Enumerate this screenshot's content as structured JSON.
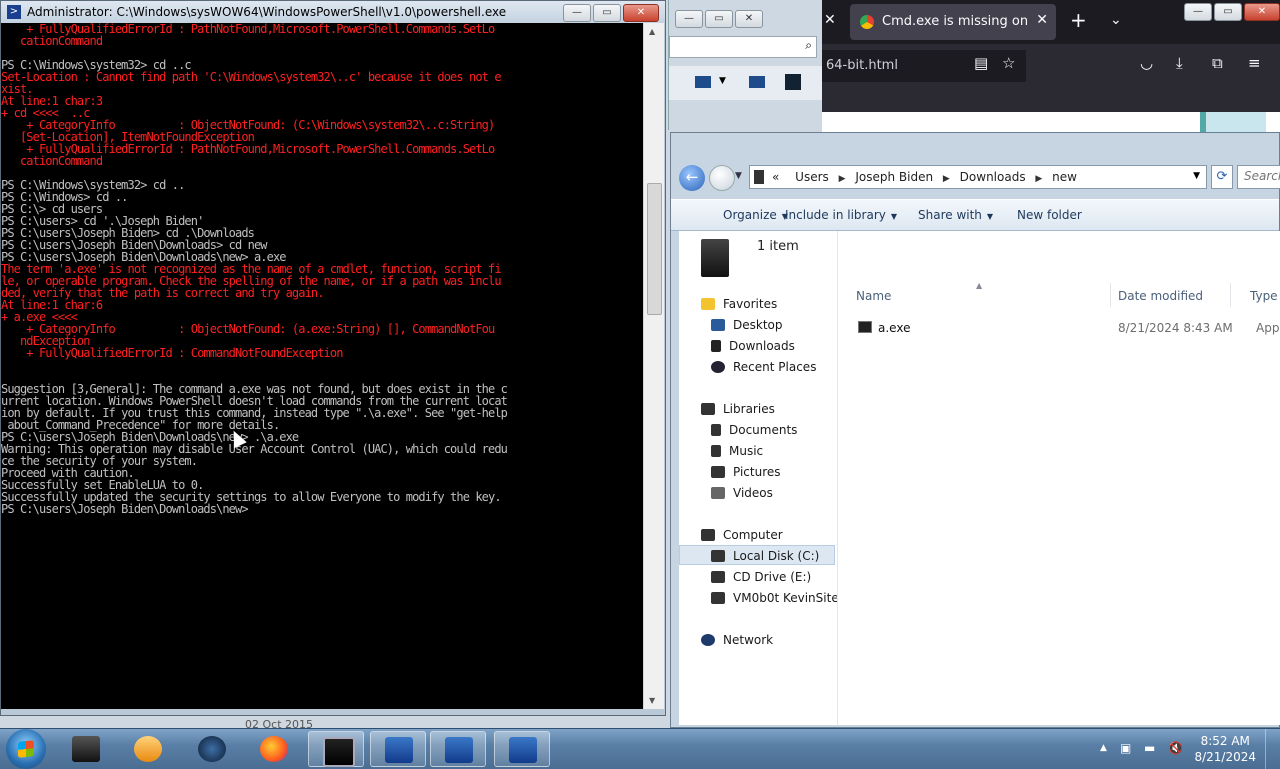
{
  "powershell": {
    "title": "Administrator: C:\\Windows\\sysWOW64\\WindowsPowerShell\\v1.0\\powershell.exe",
    "lines": [
      {
        "t": "    + FullyQualifiedErrorId : PathNotFound,Microsoft.PowerShell.Commands.SetLo",
        "c": "err"
      },
      {
        "t": "   cationCommand",
        "c": "err"
      },
      {
        "t": "",
        "c": "out"
      },
      {
        "t": "PS C:\\Windows\\system32> cd ..c",
        "c": "out"
      },
      {
        "t": "Set-Location : Cannot find path 'C:\\Windows\\system32\\..c' because it does not e",
        "c": "err"
      },
      {
        "t": "xist.",
        "c": "err"
      },
      {
        "t": "At line:1 char:3",
        "c": "err"
      },
      {
        "t": "+ cd <<<<  ..c",
        "c": "err"
      },
      {
        "t": "    + CategoryInfo          : ObjectNotFound: (C:\\Windows\\system32\\..c:String)",
        "c": "err"
      },
      {
        "t": "   [Set-Location], ItemNotFoundException",
        "c": "err"
      },
      {
        "t": "    + FullyQualifiedErrorId : PathNotFound,Microsoft.PowerShell.Commands.SetLo",
        "c": "err"
      },
      {
        "t": "   cationCommand",
        "c": "err"
      },
      {
        "t": "",
        "c": "out"
      },
      {
        "t": "PS C:\\Windows\\system32> cd ..",
        "c": "out"
      },
      {
        "t": "PS C:\\Windows> cd ..",
        "c": "out"
      },
      {
        "t": "PS C:\\> cd users",
        "c": "out"
      },
      {
        "t": "PS C:\\users> cd '.\\Joseph Biden'",
        "c": "out"
      },
      {
        "t": "PS C:\\users\\Joseph Biden> cd .\\Downloads",
        "c": "out"
      },
      {
        "t": "PS C:\\users\\Joseph Biden\\Downloads> cd new",
        "c": "out"
      },
      {
        "t": "PS C:\\users\\Joseph Biden\\Downloads\\new> a.exe",
        "c": "out"
      },
      {
        "t": "The term 'a.exe' is not recognized as the name of a cmdlet, function, script fi",
        "c": "err"
      },
      {
        "t": "le, or operable program. Check the spelling of the name, or if a path was inclu",
        "c": "err"
      },
      {
        "t": "ded, verify that the path is correct and try again.",
        "c": "err"
      },
      {
        "t": "At line:1 char:6",
        "c": "err"
      },
      {
        "t": "+ a.exe <<<<",
        "c": "err"
      },
      {
        "t": "    + CategoryInfo          : ObjectNotFound: (a.exe:String) [], CommandNotFou",
        "c": "err"
      },
      {
        "t": "   ndException",
        "c": "err"
      },
      {
        "t": "    + FullyQualifiedErrorId : CommandNotFoundException",
        "c": "err"
      },
      {
        "t": "",
        "c": "out"
      },
      {
        "t": "",
        "c": "out"
      },
      {
        "t": "Suggestion [3,General]: The command a.exe was not found, but does exist in the c",
        "c": "out"
      },
      {
        "t": "urrent location. Windows PowerShell doesn't load commands from the current locat",
        "c": "out"
      },
      {
        "t": "ion by default. If you trust this command, instead type \".\\a.exe\". See \"get-help",
        "c": "out"
      },
      {
        "t": " about_Command_Precedence\" for more details.",
        "c": "out"
      },
      {
        "t": "PS C:\\users\\Joseph Biden\\Downloads\\new> .\\a.exe",
        "c": "out"
      },
      {
        "t": "Warning: This operation may disable User Account Control (UAC), which could redu",
        "c": "out"
      },
      {
        "t": "ce the security of your system.",
        "c": "out"
      },
      {
        "t": "Proceed with caution.",
        "c": "out"
      },
      {
        "t": "Successfully set EnableLUA to 0.",
        "c": "out"
      },
      {
        "t": "Successfully updated the security settings to allow Everyone to modify the key.",
        "c": "out"
      },
      {
        "t": "PS C:\\users\\Joseph Biden\\Downloads\\new>",
        "c": "out"
      }
    ]
  },
  "behind_date": "02 Oct 2015",
  "browser": {
    "tab_title": "Cmd.exe is missing on Windo",
    "url_fragment": "64-bit.html"
  },
  "explorer": {
    "breadcrumb": [
      "Users",
      "Joseph Biden",
      "Downloads",
      "new"
    ],
    "crumb_prefix": "«",
    "search_placeholder": "Search new",
    "commands": [
      "Organize",
      "Include in library",
      "Share with",
      "New folder"
    ],
    "item_count": "1 item",
    "nav": {
      "favorites": "Favorites",
      "favorite_items": [
        "Desktop",
        "Downloads",
        "Recent Places"
      ],
      "libraries": "Libraries",
      "library_items": [
        "Documents",
        "Music",
        "Pictures",
        "Videos"
      ],
      "computer": "Computer",
      "computer_items": [
        "Local Disk (C:)",
        "CD Drive (E:)",
        "VM0b0t KevinSite"
      ],
      "network": "Network"
    },
    "columns": [
      "Name",
      "Date modified",
      "Type"
    ],
    "files": [
      {
        "name": "a.exe",
        "date": "8/21/2024 8:43 AM",
        "type": "Applicat"
      }
    ]
  },
  "taskbar": {
    "time": "8:52 AM",
    "date": "8/21/2024"
  },
  "colors": {
    "console_bg": "#000000",
    "console_text": "#c0c0c0",
    "console_error": "#ff2020",
    "firefox_dark": "#1c1b22"
  }
}
